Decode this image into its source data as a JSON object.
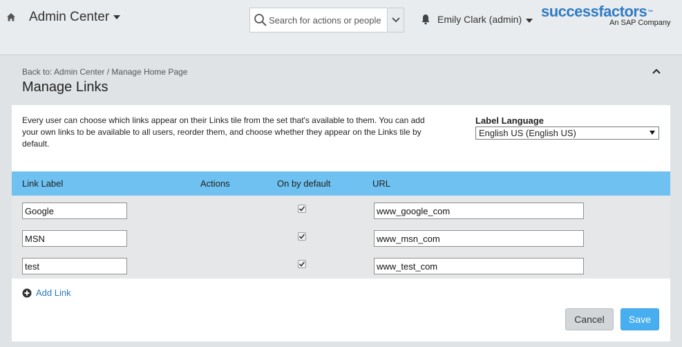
{
  "header": {
    "app_title": "Admin Center",
    "search_placeholder": "Search for actions or people",
    "user_name": "Emily Clark (admin)",
    "logo_text": "successfactors",
    "logo_tm": "™",
    "logo_sub": "An SAP Company",
    "icons": [
      "home-icon",
      "search-icon",
      "chevron-down-icon",
      "bell-icon",
      "caret-down-icon"
    ]
  },
  "page": {
    "breadcrumb": "Back to: Admin Center / Manage Home Page",
    "title": "Manage Links",
    "description": "Every user can choose which links appear on their Links tile from the set that's available to them. You can add your own links to be available to all users, reorder them, and choose whether they appear on the Links tile by default.",
    "label_language_title": "Label Language",
    "label_language_value": "English US (English US)"
  },
  "table": {
    "columns": [
      "Link Label",
      "Actions",
      "On by default",
      "URL"
    ],
    "rows": [
      {
        "label": "Google",
        "on_by_default": true,
        "url": "www_google_com"
      },
      {
        "label": "MSN",
        "on_by_default": true,
        "url": "www_msn_com"
      },
      {
        "label": "test",
        "on_by_default": true,
        "url": "www_test_com"
      }
    ]
  },
  "actions": {
    "add_link": "Add Link",
    "cancel": "Cancel",
    "save": "Save"
  },
  "colors": {
    "accent": "#47aef0",
    "table_header": "#6ec1f0",
    "logo": "#2f7bc4",
    "link": "#2a7ab8"
  }
}
